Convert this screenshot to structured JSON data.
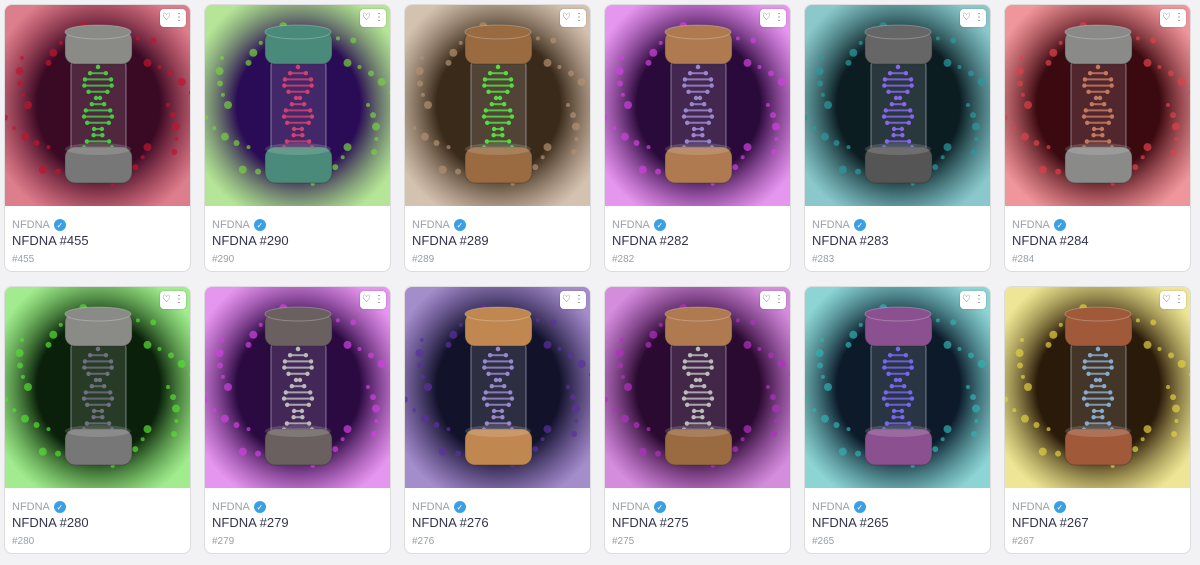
{
  "collection_name": "NFDNA",
  "favorite_icon": "heart-icon",
  "menu_icon": "more-vertical-icon",
  "verified_icon": "verified-check-icon",
  "cards": [
    {
      "name": "NFDNA #455",
      "token": "#455",
      "bg": "#3a0a25",
      "glow": "#c0142e",
      "cap": "#8a8a86",
      "helix": "#44cc44",
      "case": "#777777"
    },
    {
      "name": "NFDNA #290",
      "token": "#290",
      "bg": "#2a0b55",
      "glow": "#79d042",
      "cap": "#4a8a7a",
      "helix": "#d04070",
      "case": "#4a8a7a"
    },
    {
      "name": "NFDNA #289",
      "token": "#289",
      "bg": "#3a2a1a",
      "glow": "#b09070",
      "cap": "#9a6a40",
      "helix": "#55dd44",
      "case": "#9a6a40"
    },
    {
      "name": "NFDNA #282",
      "token": "#282",
      "bg": "#2a0a3a",
      "glow": "#d040e0",
      "cap": "#b07a50",
      "helix": "#9a88cc",
      "case": "#b07a50"
    },
    {
      "name": "NFDNA #283",
      "token": "#283",
      "bg": "#0c1d22",
      "glow": "#2a9aa0",
      "cap": "#666666",
      "helix": "#8866ee",
      "case": "#555555"
    },
    {
      "name": "NFDNA #284",
      "token": "#284",
      "bg": "#3a0a10",
      "glow": "#e0404a",
      "cap": "#8a8a88",
      "helix": "#c27a60",
      "case": "#8a8a88"
    },
    {
      "name": "NFDNA #280",
      "token": "#280",
      "bg": "#0a200a",
      "glow": "#55dd33",
      "cap": "#8a8a86",
      "helix": "#707080",
      "case": "#777777"
    },
    {
      "name": "NFDNA #279",
      "token": "#279",
      "bg": "#2a0a40",
      "glow": "#d040e0",
      "cap": "#6a6060",
      "helix": "#bbbbbb",
      "case": "#6a6060"
    },
    {
      "name": "NFDNA #276",
      "token": "#276",
      "bg": "#12122a",
      "glow": "#5a30a0",
      "cap": "#c08850",
      "helix": "#9a88cc",
      "case": "#c08850"
    },
    {
      "name": "NFDNA #275",
      "token": "#275",
      "bg": "#2a0a30",
      "glow": "#b030c0",
      "cap": "#b07a50",
      "helix": "#bbbbbb",
      "case": "#9a6a40"
    },
    {
      "name": "NFDNA #265",
      "token": "#265",
      "bg": "#0c1a2a",
      "glow": "#30b0b0",
      "cap": "#8a5090",
      "helix": "#7766ee",
      "case": "#8a5090"
    },
    {
      "name": "NFDNA #267",
      "token": "#267",
      "bg": "#2a1a0a",
      "glow": "#e0d040",
      "cap": "#a05a3a",
      "helix": "#88aacc",
      "case": "#a05a3a"
    }
  ]
}
